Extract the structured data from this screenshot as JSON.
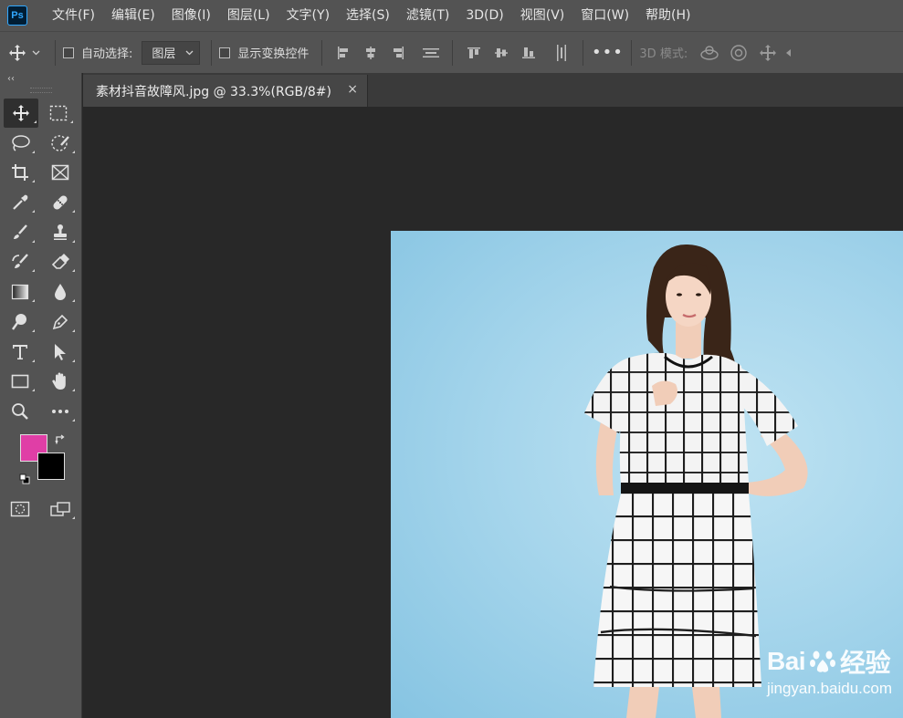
{
  "app": {
    "logo_text": "Ps"
  },
  "menu": [
    "文件(F)",
    "编辑(E)",
    "图像(I)",
    "图层(L)",
    "文字(Y)",
    "选择(S)",
    "滤镜(T)",
    "3D(D)",
    "视图(V)",
    "窗口(W)",
    "帮助(H)"
  ],
  "options": {
    "auto_select_label": "自动选择:",
    "auto_select_value": "图层",
    "show_transform_label": "显示变换控件",
    "more_label": "•••",
    "mode3d_label": "3D 模式:"
  },
  "toolbar": {
    "collapse_label": "‹‹",
    "foreground_color": "#e03ea6",
    "background_color": "#000000"
  },
  "document": {
    "tab_title": "素材抖音故障风.jpg @ 33.3%(RGB/8#)",
    "close_label": "×"
  },
  "watermark": {
    "brand_prefix": "Bai",
    "brand_suffix": "经验",
    "url": "jingyan.baidu.com"
  }
}
